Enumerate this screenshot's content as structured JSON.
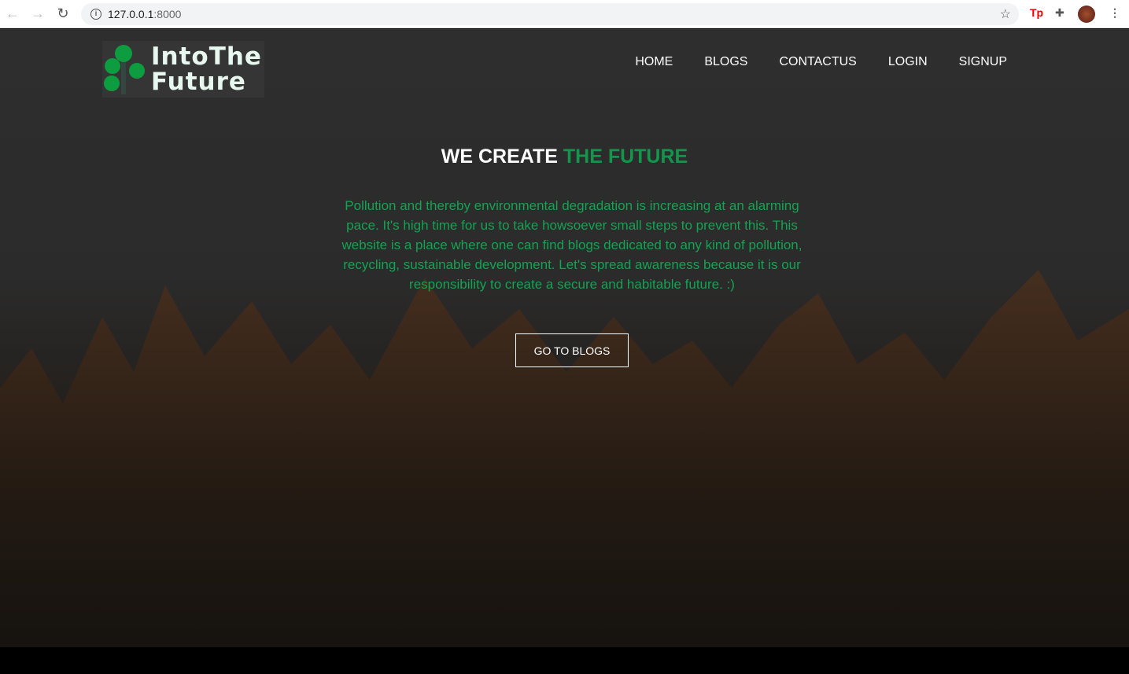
{
  "browser": {
    "url_host": "127.0.0.1",
    "url_port": ":8000",
    "ext_label": "Tp"
  },
  "logo": {
    "line1": "IntoThe",
    "line2": "Future"
  },
  "nav": [
    "HOME",
    "BLOGS",
    "CONTACTUS",
    "LOGIN",
    "SIGNUP"
  ],
  "hero": {
    "title_white": "WE CREATE ",
    "title_green": "THE FUTURE",
    "description": "Pollution and thereby environmental degradation is increasing at an alarming pace. It's high time for us to take howsoever small steps to prevent this. This website is a place where one can find blogs dedicated to any kind of pollution, recycling, sustainable development. Let's spread awareness because it is our responsibility to create a secure and habitable future. :)",
    "button": "GO TO BLOGS"
  },
  "colors": {
    "accent": "#13964c"
  }
}
